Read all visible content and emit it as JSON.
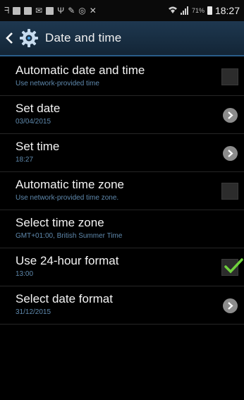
{
  "status_bar": {
    "battery": "71%",
    "time": "18:27"
  },
  "header": {
    "title": "Date and time"
  },
  "settings": [
    {
      "title": "Automatic date and time",
      "subtitle": "Use network-provided time",
      "control": "checkbox",
      "checked": false
    },
    {
      "title": "Set date",
      "subtitle": "03/04/2015",
      "control": "chevron"
    },
    {
      "title": "Set time",
      "subtitle": "18:27",
      "control": "chevron"
    },
    {
      "title": "Automatic time zone",
      "subtitle": "Use network-provided time zone.",
      "control": "checkbox",
      "checked": false
    },
    {
      "title": "Select time zone",
      "subtitle": "GMT+01:00, British Summer Time",
      "control": "none"
    },
    {
      "title": "Use 24-hour format",
      "subtitle": "13:00",
      "control": "checkbox",
      "checked": true
    },
    {
      "title": "Select date format",
      "subtitle": "31/12/2015",
      "control": "chevron"
    }
  ],
  "colors": {
    "accent_check": "#6fd13d",
    "subtitle": "#5f89ad",
    "header_bg": "#1a3046"
  }
}
